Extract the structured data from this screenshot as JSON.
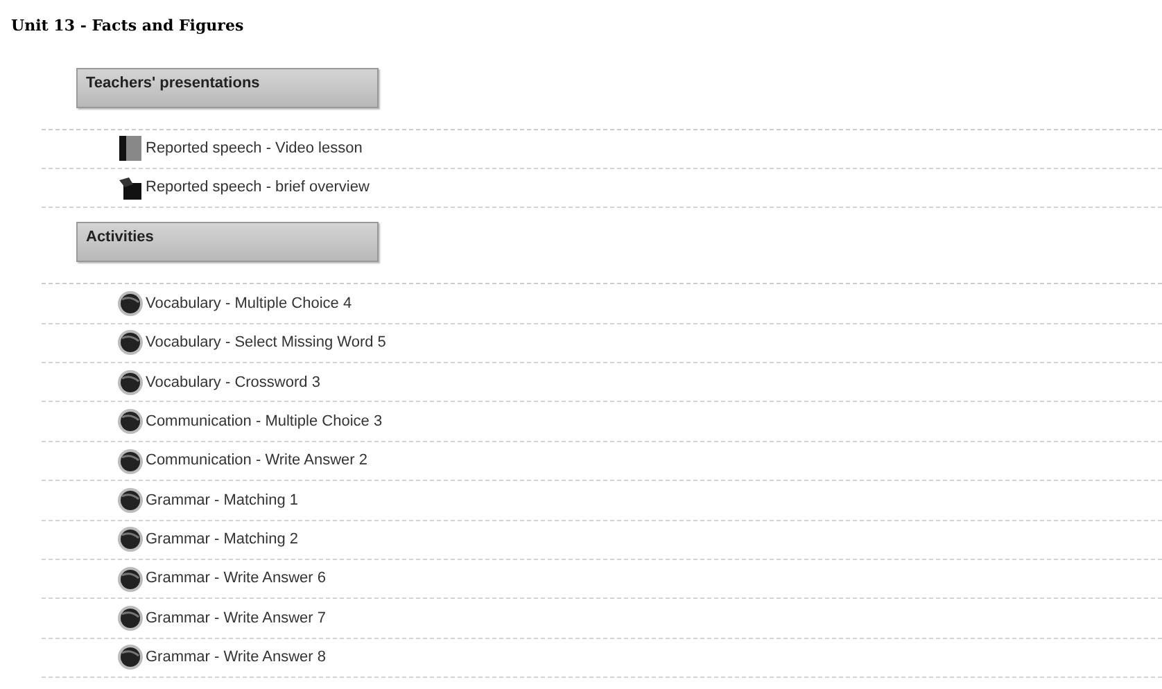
{
  "title": "Unit 13 - Facts and Figures",
  "sections": [
    {
      "heading": "Teachers' presentations",
      "items": [
        {
          "label": "Reported speech - Video lesson",
          "kind": "video"
        },
        {
          "label": "Reported speech - brief overview",
          "kind": "presentation"
        }
      ]
    },
    {
      "heading": "Activities",
      "items": [
        {
          "label": "Vocabulary - Multiple Choice 4",
          "kind": "activity"
        },
        {
          "label": "Vocabulary - Select Missing Word 5",
          "kind": "activity"
        },
        {
          "label": "Vocabulary - Crossword 3",
          "kind": "activity"
        },
        {
          "label": "Communication - Multiple Choice 3",
          "kind": "activity"
        },
        {
          "label": "Communication - Write Answer 2",
          "kind": "activity"
        },
        {
          "label": "Grammar - Matching 1",
          "kind": "activity"
        },
        {
          "label": "Grammar - Matching 2",
          "kind": "activity"
        },
        {
          "label": "Grammar - Write Answer 6",
          "kind": "activity"
        },
        {
          "label": "Grammar - Write Answer 7",
          "kind": "activity"
        },
        {
          "label": "Grammar - Write Answer 8",
          "kind": "activity"
        }
      ]
    }
  ]
}
